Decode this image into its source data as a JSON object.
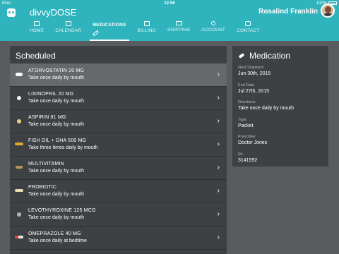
{
  "status_bar": {
    "carrier": "iPad",
    "time": "12:56",
    "battery": "100%"
  },
  "header": {
    "app_title": "divvyDOSE",
    "user_name": "Rosalind Franklin"
  },
  "nav": {
    "tabs": [
      {
        "label": "HOME",
        "icon": "home-icon",
        "active": false
      },
      {
        "label": "CALENDAR",
        "icon": "calendar-icon",
        "active": false
      },
      {
        "label": "MEDICATIONS",
        "icon": "pill-icon",
        "active": true
      },
      {
        "label": "BILLING",
        "icon": "credit-card-icon",
        "active": false
      },
      {
        "label": "SHIPPING",
        "icon": "truck-icon",
        "active": false
      },
      {
        "label": "ACCOUNT",
        "icon": "person-icon",
        "active": false
      },
      {
        "label": "CONTACT",
        "icon": "chat-icon",
        "active": false
      }
    ]
  },
  "scheduled": {
    "title": "Scheduled",
    "items": [
      {
        "name": "ATORVOSTATIN 20 MG",
        "directions": "Take once daily by mouth",
        "pill_color": "#ffffff",
        "pill_shape": "oval",
        "selected": true
      },
      {
        "name": "LISINOPRIL 20 MG",
        "directions": "Take once daily by mouth",
        "pill_color": "#f5f1e6",
        "pill_shape": "round",
        "selected": false
      },
      {
        "name": "ASPIRIN 81 MG",
        "directions": "Take once daily by mouth",
        "pill_color": "#e9d37a",
        "pill_shape": "round",
        "selected": false
      },
      {
        "name": "FISH OIL + DHA 500 MG",
        "directions": "Take three times daily by mouth",
        "pill_color": "#e3a92e",
        "pill_shape": "capsule",
        "selected": false
      },
      {
        "name": "MULTIVITAMIN",
        "directions": "Take once daily by mouth",
        "pill_color": "#b8935c",
        "pill_shape": "long",
        "selected": false
      },
      {
        "name": "PROBIOTIC",
        "directions": "Take once daily by mouth",
        "pill_color": "#e8dcb0",
        "pill_shape": "capsule",
        "selected": false
      },
      {
        "name": "LEVOTHYROXINE 125 MCG",
        "directions": "Take once daily by mouth",
        "pill_color": "#b9b3ae",
        "pill_shape": "round",
        "selected": false
      },
      {
        "name": "OMEPRAZOLE 40 MG",
        "directions": "Take once daily at bedtime",
        "pill_color": "#ece8e4",
        "pill_shape": "split",
        "selected": false
      }
    ]
  },
  "medication": {
    "title": "Medication",
    "fields": [
      {
        "label": "Next Shipment",
        "value": "Jun 30th, 2015"
      },
      {
        "label": "End Date",
        "value": "Jul 27th, 2015"
      },
      {
        "label": "Directions",
        "value": "Take once daily by mouth"
      },
      {
        "label": "Type",
        "value": "Packet"
      },
      {
        "label": "Prescriber",
        "value": "Doctor Jones"
      },
      {
        "label": "Rx",
        "value": "3141592"
      }
    ]
  },
  "colors": {
    "brand": "#2fb3bd",
    "background": "#595c5e",
    "panel": "#3e4144",
    "selected_row": "#66696c"
  }
}
